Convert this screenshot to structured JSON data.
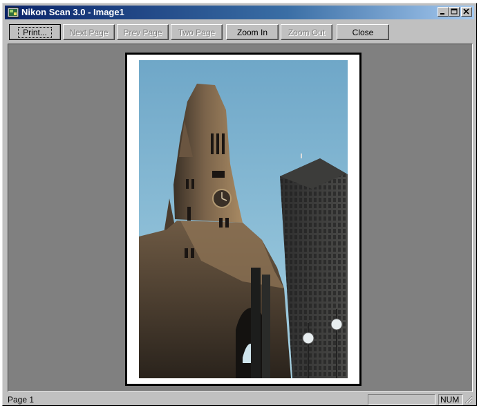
{
  "window": {
    "title": "Nikon Scan 3.0 - Image1",
    "icon": "nikon-scan-app-icon",
    "controls": {
      "minimize": "minimize-icon",
      "maximize": "maximize-icon",
      "close": "close-icon"
    }
  },
  "toolbar": {
    "print": "Print...",
    "next_page": "Next Page",
    "prev_page": "Prev Page",
    "two_page": "Two Page",
    "zoom_in": "Zoom In",
    "zoom_out": "Zoom Out",
    "close": "Close"
  },
  "statusbar": {
    "page": "Page 1",
    "progress": "",
    "num": "NUM"
  },
  "colors": {
    "title_gradient_start": "#0a246a",
    "title_gradient_end": "#a6caf0",
    "face": "#c0c0c0",
    "viewport_bg": "#808080"
  }
}
